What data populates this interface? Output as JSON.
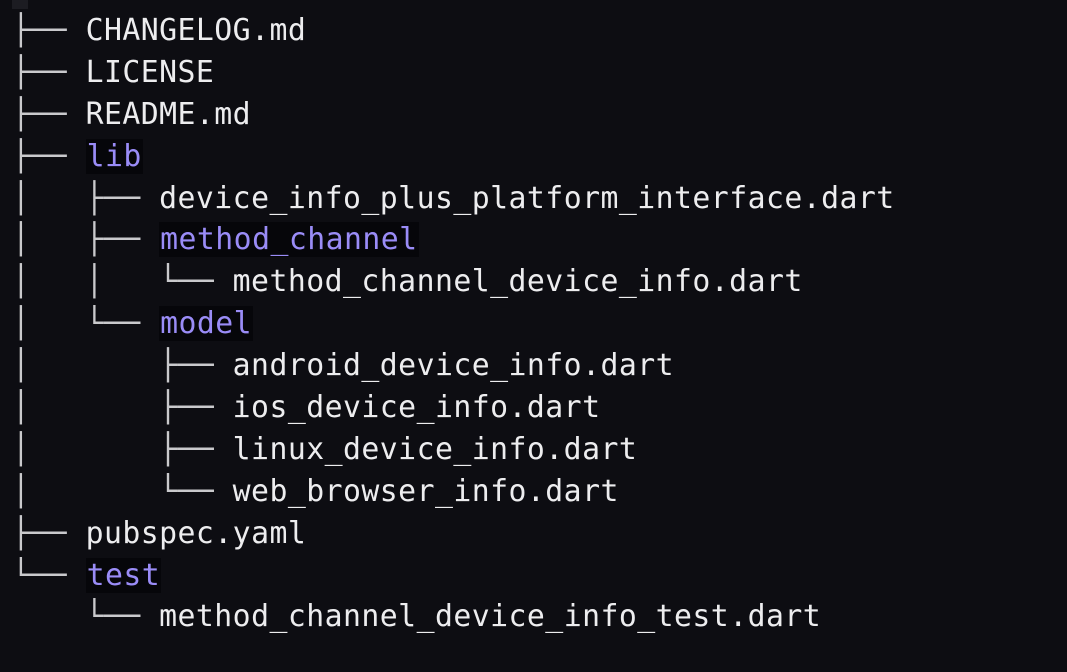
{
  "tree": {
    "colors": {
      "background": "#0d0d12",
      "file": "#ededef",
      "directory": "#9a8cf7",
      "branch": "#c9c9cc"
    },
    "rows": [
      {
        "prefix": "├── ",
        "name": "CHANGELOG.md",
        "type": "file"
      },
      {
        "prefix": "├── ",
        "name": "LICENSE",
        "type": "file"
      },
      {
        "prefix": "├── ",
        "name": "README.md",
        "type": "file"
      },
      {
        "prefix": "├── ",
        "name": "lib",
        "type": "dir"
      },
      {
        "prefix": "│   ├── ",
        "name": "device_info_plus_platform_interface.dart",
        "type": "file"
      },
      {
        "prefix": "│   ├── ",
        "name": "method_channel",
        "type": "dir"
      },
      {
        "prefix": "│   │   └── ",
        "name": "method_channel_device_info.dart",
        "type": "file"
      },
      {
        "prefix": "│   └── ",
        "name": "model",
        "type": "dir"
      },
      {
        "prefix": "│       ├── ",
        "name": "android_device_info.dart",
        "type": "file"
      },
      {
        "prefix": "│       ├── ",
        "name": "ios_device_info.dart",
        "type": "file"
      },
      {
        "prefix": "│       ├── ",
        "name": "linux_device_info.dart",
        "type": "file"
      },
      {
        "prefix": "│       └── ",
        "name": "web_browser_info.dart",
        "type": "file"
      },
      {
        "prefix": "├── ",
        "name": "pubspec.yaml",
        "type": "file"
      },
      {
        "prefix": "└── ",
        "name": "test",
        "type": "dir"
      },
      {
        "prefix": "    └── ",
        "name": "method_channel_device_info_test.dart",
        "type": "file"
      }
    ]
  }
}
